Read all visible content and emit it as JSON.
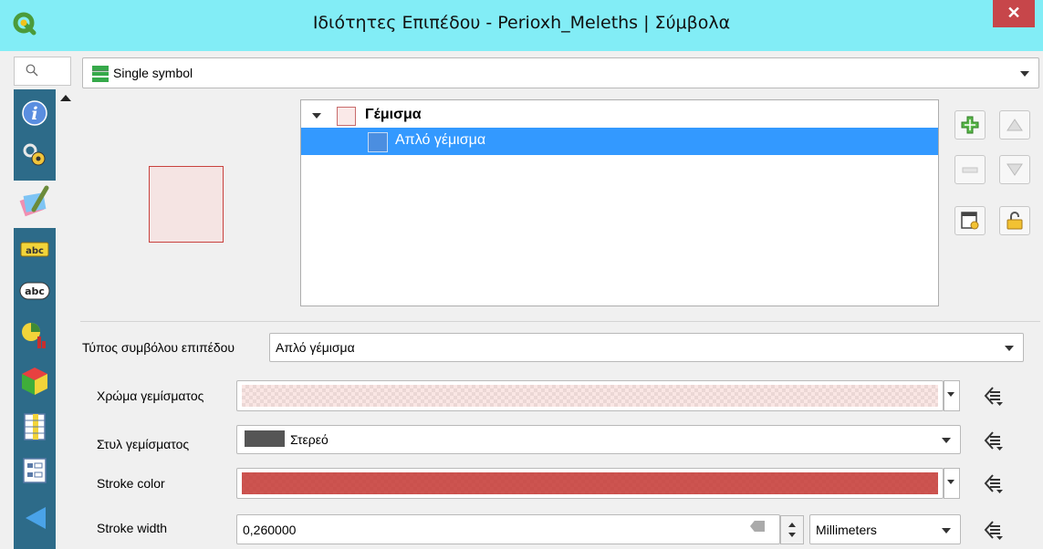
{
  "window": {
    "title": "Ιδιότητες Επιπέδου - Perioxh_Meleths | Σύμβολα",
    "close_label": "✕"
  },
  "renderer": {
    "selected": "Single symbol"
  },
  "symbol_tree": {
    "parent": "Γέμισμα",
    "child": "Απλό γέμισμα"
  },
  "layer_type": {
    "label": "Τύπος συμβόλου επιπέδου",
    "value": "Απλό γέμισμα"
  },
  "fill_color": {
    "label": "Χρώμα γεμίσματος",
    "color": "#f5e4e3"
  },
  "fill_style": {
    "label": "Στυλ γεμίσματος",
    "value": "Στερεό"
  },
  "stroke_color": {
    "label": "Stroke color",
    "color": "#c8413d"
  },
  "stroke_width": {
    "label": "Stroke width",
    "value": "0,260000",
    "unit": "Millimeters"
  },
  "sidebar": {
    "items": [
      "information-icon",
      "source-icon",
      "symbology-icon",
      "labels-icon",
      "abc-labels-icon",
      "diagrams-icon",
      "3d-view-icon",
      "fields-icon",
      "attributes-form-icon",
      "joins-icon"
    ]
  },
  "colors": {
    "titlebar": "#82edf6",
    "sidebar": "#2d6b89",
    "selection": "#3399ff",
    "close": "#c7464a"
  }
}
